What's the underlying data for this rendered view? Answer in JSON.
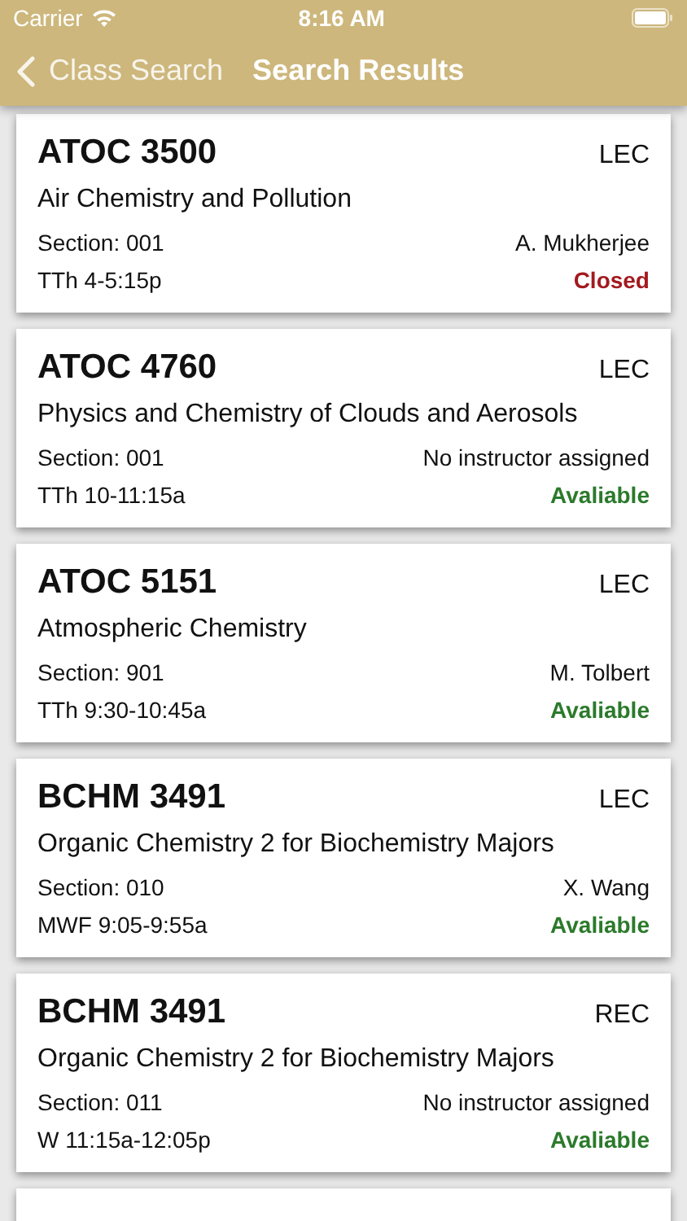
{
  "status_bar": {
    "carrier": "Carrier",
    "time": "8:16 AM"
  },
  "nav": {
    "back": "Class Search",
    "title": "Search Results"
  },
  "results": [
    {
      "code": "ATOC 3500",
      "type": "LEC",
      "title": "Air Chemistry and Pollution",
      "section": "Section: 001",
      "instructor": "A. Mukherjee",
      "time": "TTh 4-5:15p",
      "status": "Closed",
      "kind": "closed"
    },
    {
      "code": "ATOC 4760",
      "type": "LEC",
      "title": "Physics and Chemistry of Clouds and Aerosols",
      "section": "Section: 001",
      "instructor": "No instructor assigned",
      "time": "TTh 10-11:15a",
      "status": "Avaliable",
      "kind": "open"
    },
    {
      "code": "ATOC 5151",
      "type": "LEC",
      "title": "Atmospheric Chemistry",
      "section": "Section: 901",
      "instructor": "M. Tolbert",
      "time": "TTh 9:30-10:45a",
      "status": "Avaliable",
      "kind": "open"
    },
    {
      "code": "BCHM 3491",
      "type": "LEC",
      "title": "Organic Chemistry 2 for Biochemistry Majors",
      "section": "Section: 010",
      "instructor": "X. Wang",
      "time": "MWF 9:05-9:55a",
      "status": "Avaliable",
      "kind": "open"
    },
    {
      "code": "BCHM 3491",
      "type": "REC",
      "title": "Organic Chemistry 2 for Biochemistry Majors",
      "section": "Section: 011",
      "instructor": "No instructor assigned",
      "time": "W 11:15a-12:05p",
      "status": "Avaliable",
      "kind": "open"
    }
  ]
}
